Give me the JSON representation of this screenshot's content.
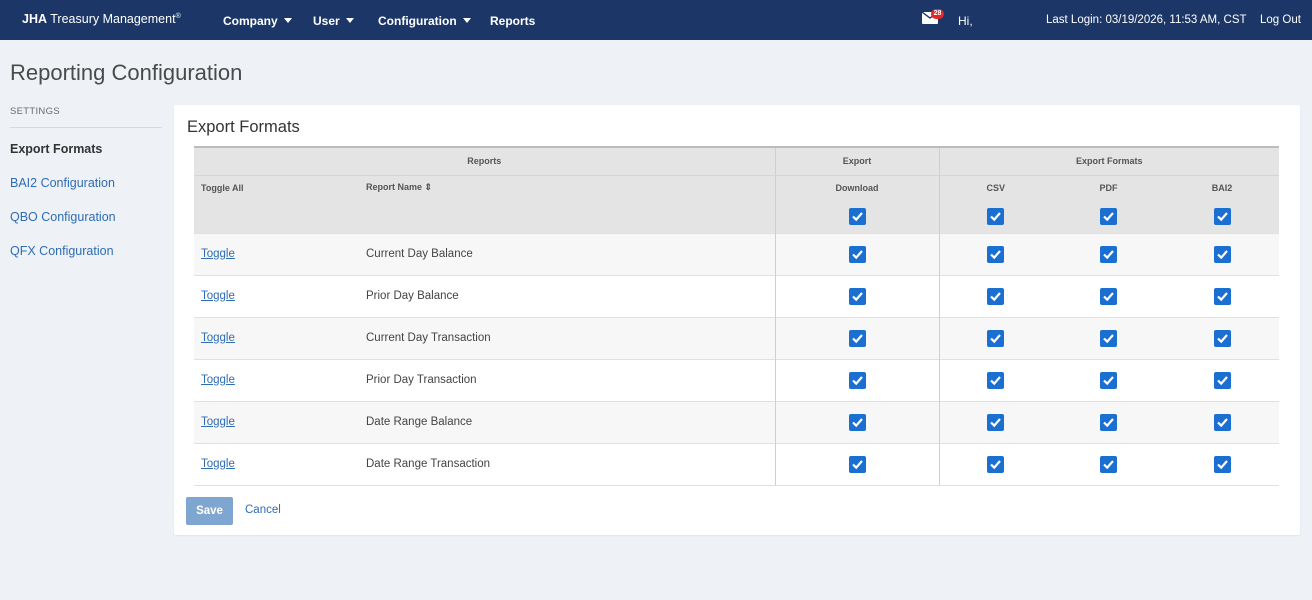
{
  "nav": {
    "brand_bold": "JHA",
    "brand_rest": "Treasury Management",
    "brand_mark": "®",
    "menu": [
      {
        "label": "Company"
      },
      {
        "label": "User"
      },
      {
        "label": "Configuration"
      },
      {
        "label": "Reports"
      }
    ],
    "mail_count": "28",
    "greeting": "Hi,",
    "last_login": "Last Login: 03/19/2026, 11:53 AM, CST",
    "logout": "Log Out"
  },
  "page": {
    "title": "Reporting Configuration"
  },
  "sidebar": {
    "section_label": "SETTINGS",
    "items": [
      {
        "label": "Export Formats",
        "active": true
      },
      {
        "label": "BAI2 Configuration"
      },
      {
        "label": "QBO Configuration"
      },
      {
        "label": "QFX Configuration"
      }
    ]
  },
  "card": {
    "title": "Export Formats",
    "table": {
      "group_headers": {
        "reports": "Reports",
        "export": "Export",
        "export_formats": "Export Formats"
      },
      "columns": {
        "toggle_all": "Toggle All",
        "report_name": "Report Name ⇕",
        "download": "Download",
        "csv": "CSV",
        "pdf": "PDF",
        "bai2": "BAI2"
      },
      "rows": [
        {
          "toggle": "Toggle",
          "name": "Current Day Balance",
          "download": true,
          "csv": true,
          "pdf": true,
          "bai2": true
        },
        {
          "toggle": "Toggle",
          "name": "Prior Day Balance",
          "download": true,
          "csv": true,
          "pdf": true,
          "bai2": true
        },
        {
          "toggle": "Toggle",
          "name": "Current Day Transaction",
          "download": true,
          "csv": true,
          "pdf": true,
          "bai2": true
        },
        {
          "toggle": "Toggle",
          "name": "Prior Day Transaction",
          "download": true,
          "csv": true,
          "pdf": true,
          "bai2": true
        },
        {
          "toggle": "Toggle",
          "name": "Date Range Balance",
          "download": true,
          "csv": true,
          "pdf": true,
          "bai2": true
        },
        {
          "toggle": "Toggle",
          "name": "Date Range Transaction",
          "download": true,
          "csv": true,
          "pdf": true,
          "bai2": true
        }
      ]
    },
    "save_label": "Save",
    "cancel_label": "Cancel"
  },
  "colors": {
    "nav_bg": "#1c3767",
    "accent": "#1a6fd0",
    "link": "#2f6cb3",
    "badge": "#e02828"
  }
}
